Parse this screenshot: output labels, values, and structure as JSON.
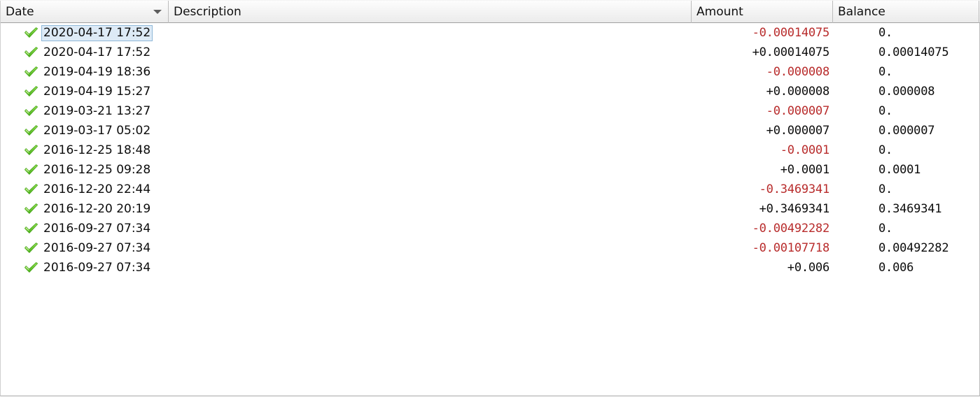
{
  "table": {
    "columns": [
      {
        "key": "date",
        "label": "Date",
        "sort": "descending",
        "sort_icon": "chevron-down-icon"
      },
      {
        "key": "description",
        "label": "Description",
        "sort": "none",
        "sort_icon": ""
      },
      {
        "key": "amount",
        "label": "Amount",
        "sort": "none",
        "sort_icon": ""
      },
      {
        "key": "balance",
        "label": "Balance",
        "sort": "none",
        "sort_icon": ""
      }
    ],
    "selected_row_index": 0,
    "row_status_icon": "green-check-icon",
    "colors": {
      "negative_amount": "#b82b2b",
      "positive_amount": "#0c0c0c",
      "selection_background": "#ddeaf6",
      "selection_border": "#8fb8d8",
      "status_icon_green": "#5ec12b",
      "header_border": "#a0a0a0"
    },
    "rows": [
      {
        "status": "confirmed",
        "date": "2020-04-17 17:52",
        "description": "",
        "amount": "-0.00014075",
        "amount_sign": "negative",
        "balance": "0."
      },
      {
        "status": "confirmed",
        "date": "2020-04-17 17:52",
        "description": "",
        "amount": "+0.00014075",
        "amount_sign": "positive",
        "balance": "0.00014075"
      },
      {
        "status": "confirmed",
        "date": "2019-04-19 18:36",
        "description": "",
        "amount": "-0.000008",
        "amount_sign": "negative",
        "balance": "0."
      },
      {
        "status": "confirmed",
        "date": "2019-04-19 15:27",
        "description": "",
        "amount": "+0.000008",
        "amount_sign": "positive",
        "balance": "0.000008"
      },
      {
        "status": "confirmed",
        "date": "2019-03-21 13:27",
        "description": "",
        "amount": "-0.000007",
        "amount_sign": "negative",
        "balance": "0."
      },
      {
        "status": "confirmed",
        "date": "2019-03-17 05:02",
        "description": "",
        "amount": "+0.000007",
        "amount_sign": "positive",
        "balance": "0.000007"
      },
      {
        "status": "confirmed",
        "date": "2016-12-25 18:48",
        "description": "",
        "amount": "-0.0001",
        "amount_sign": "negative",
        "balance": "0."
      },
      {
        "status": "confirmed",
        "date": "2016-12-25 09:28",
        "description": "",
        "amount": "+0.0001",
        "amount_sign": "positive",
        "balance": "0.0001"
      },
      {
        "status": "confirmed",
        "date": "2016-12-20 22:44",
        "description": "",
        "amount": "-0.3469341",
        "amount_sign": "negative",
        "balance": "0."
      },
      {
        "status": "confirmed",
        "date": "2016-12-20 20:19",
        "description": "",
        "amount": "+0.3469341",
        "amount_sign": "positive",
        "balance": "0.3469341"
      },
      {
        "status": "confirmed",
        "date": "2016-09-27 07:34",
        "description": "",
        "amount": "-0.00492282",
        "amount_sign": "negative",
        "balance": "0."
      },
      {
        "status": "confirmed",
        "date": "2016-09-27 07:34",
        "description": "",
        "amount": "-0.00107718",
        "amount_sign": "negative",
        "balance": "0.00492282"
      },
      {
        "status": "confirmed",
        "date": "2016-09-27 07:34",
        "description": "",
        "amount": "+0.006",
        "amount_sign": "positive",
        "balance": "0.006"
      }
    ]
  }
}
